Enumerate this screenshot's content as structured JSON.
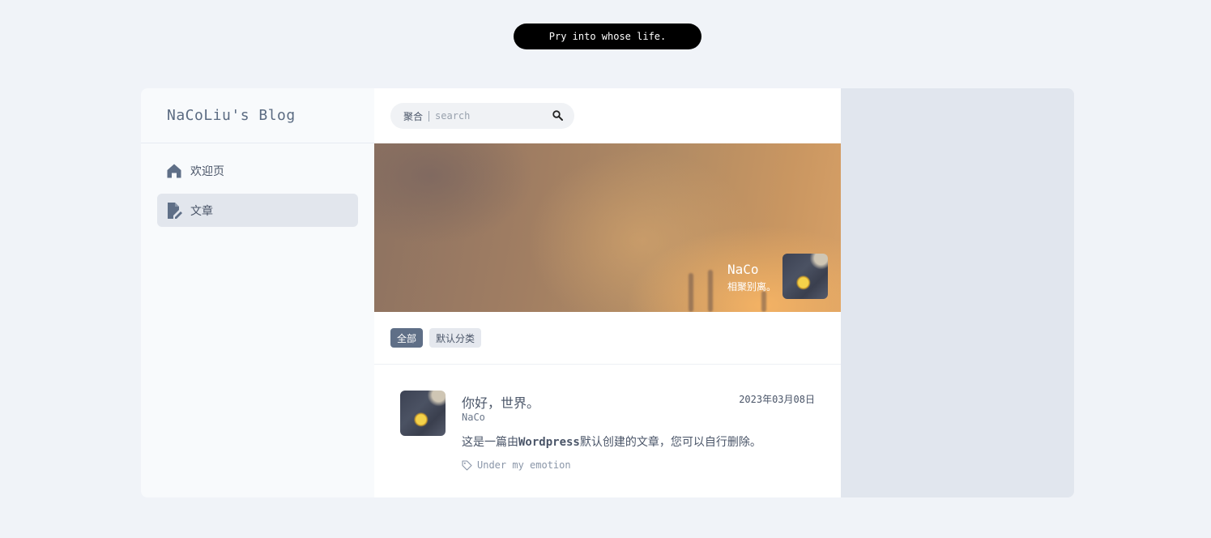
{
  "top_pill": {
    "text": "Pry into whose life."
  },
  "sidebar": {
    "blog_title": "NaCoLiu's Blog",
    "items": [
      {
        "label": "欢迎页",
        "icon": "home-icon",
        "active": false
      },
      {
        "label": "文章",
        "icon": "edit-document-icon",
        "active": true
      }
    ]
  },
  "search": {
    "scope": "聚合",
    "placeholder": "search",
    "icon": "search-icon"
  },
  "banner": {
    "name": "NaCo",
    "motto": "相聚别离。"
  },
  "categories": [
    {
      "label": "全部",
      "active": true
    },
    {
      "label": "默认分类",
      "active": false
    }
  ],
  "post": {
    "title": "你好，世界。",
    "date": "2023年03月08日",
    "author": "NaCo",
    "excerpt_before": "这是一篇由",
    "excerpt_bold": "Wordpress",
    "excerpt_after": "默认创建的文章，您可以自行删除。",
    "tag": "Under my emotion",
    "tag_icon": "tag-icon"
  },
  "colors": {
    "background": "#f0f3f8",
    "accent": "#5f6f87",
    "pill": "#000000",
    "right_panel": "#e1e6ee"
  }
}
